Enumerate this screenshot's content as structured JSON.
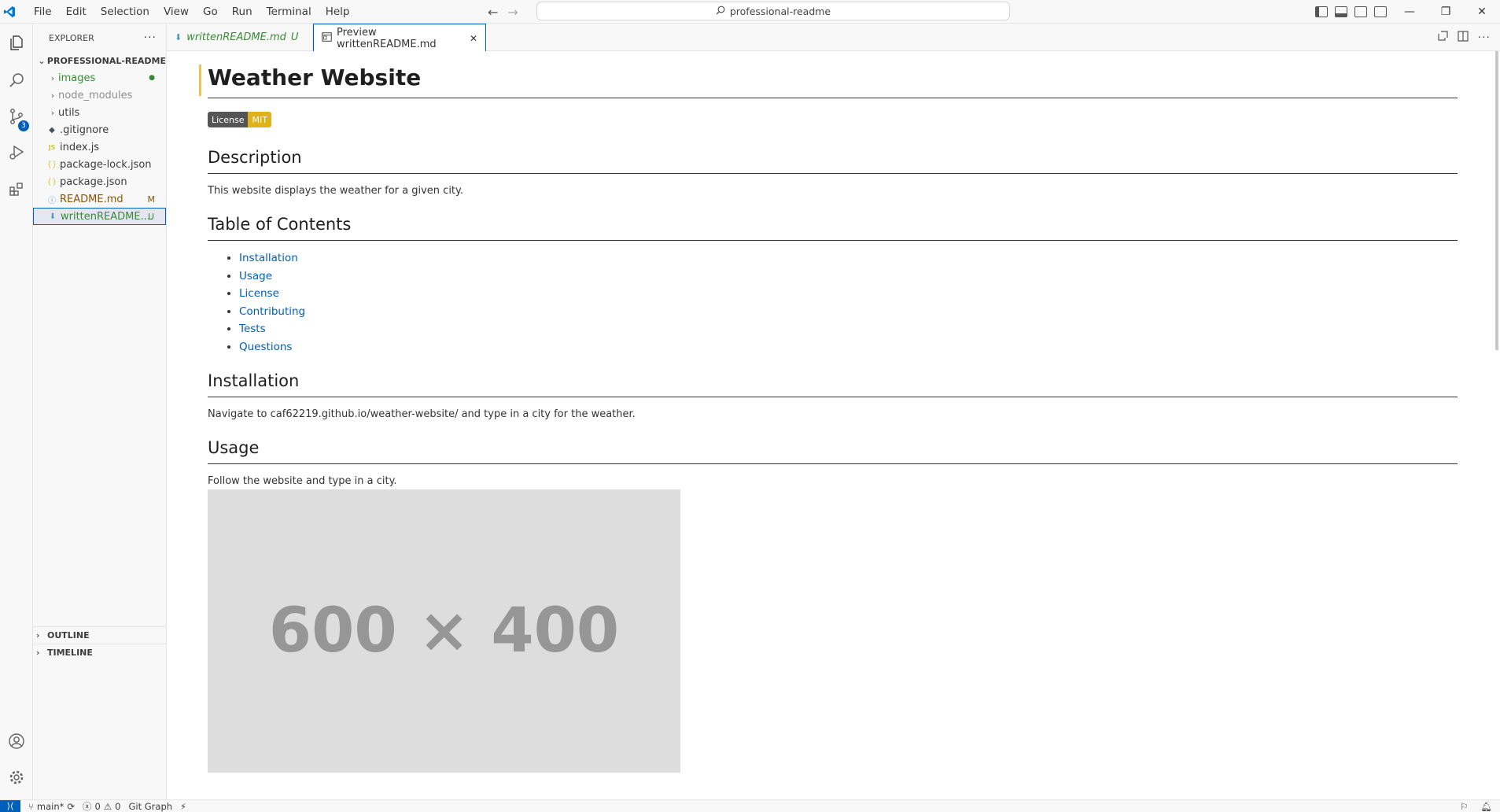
{
  "titlebar": {
    "menus": [
      "File",
      "Edit",
      "Selection",
      "View",
      "Go",
      "Run",
      "Terminal",
      "Help"
    ],
    "search_text": "professional-readme"
  },
  "activity": {
    "scm_badge": "3"
  },
  "sidebar": {
    "title": "EXPLORER",
    "root": "PROFESSIONAL-README",
    "items": [
      {
        "label": "images",
        "type": "folder",
        "deco": "●"
      },
      {
        "label": "node_modules",
        "type": "folder",
        "deco": ""
      },
      {
        "label": "utils",
        "type": "folder",
        "deco": ""
      },
      {
        "label": ".gitignore",
        "type": "file",
        "deco": ""
      },
      {
        "label": "index.js",
        "type": "file",
        "deco": ""
      },
      {
        "label": "package-lock.json",
        "type": "file",
        "deco": ""
      },
      {
        "label": "package.json",
        "type": "file",
        "deco": ""
      },
      {
        "label": "README.md",
        "type": "file",
        "deco": "M"
      },
      {
        "label": "writtenREADME....",
        "type": "file",
        "deco": "U"
      }
    ],
    "outline": "OUTLINE",
    "timeline": "TIMELINE"
  },
  "tabs": [
    {
      "label": "writtenREADME.md",
      "status": "U"
    },
    {
      "label": "Preview writtenREADME.md",
      "close": "✕"
    }
  ],
  "preview": {
    "title": "Weather Website",
    "badge_left": "License",
    "badge_right": "MIT",
    "description_heading": "Description",
    "description_text": "This website displays the weather for a given city.",
    "toc_heading": "Table of Contents",
    "toc": [
      "Installation",
      "Usage",
      "License",
      "Contributing",
      "Tests",
      "Questions"
    ],
    "installation_heading": "Installation",
    "installation_text": "Navigate to caf62219.github.io/weather-website/ and type in a city for the weather.",
    "usage_heading": "Usage",
    "usage_text": "Follow the website and type in a city.",
    "image_text": "600 × 400"
  },
  "statusbar": {
    "branch": "main*",
    "errors": "0",
    "warnings": "0",
    "git_graph": "Git Graph"
  },
  "colors": {
    "accent": "#005fb8",
    "added": "#388a34",
    "modified": "#895503",
    "badge_mit": "#dfb317"
  }
}
